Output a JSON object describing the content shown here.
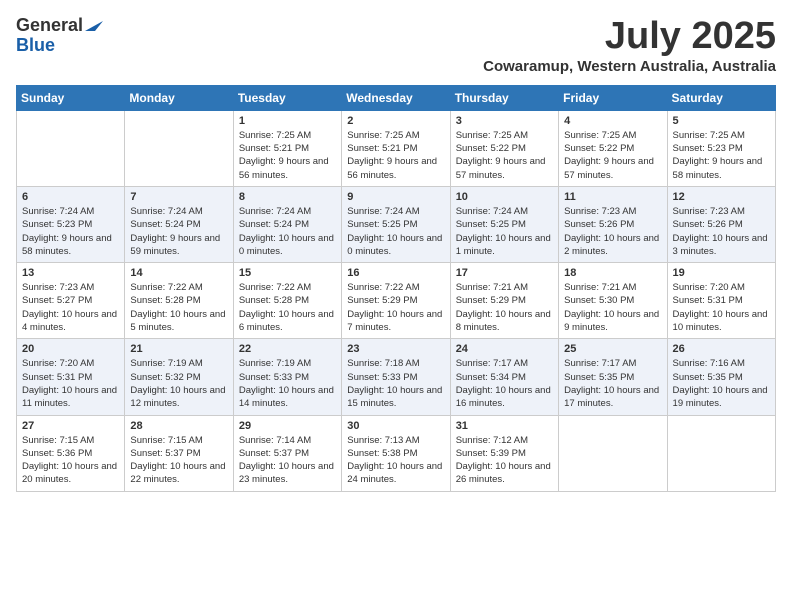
{
  "logo": {
    "general": "General",
    "blue": "Blue"
  },
  "title": {
    "month": "July 2025",
    "location": "Cowaramup, Western Australia, Australia"
  },
  "days_of_week": [
    "Sunday",
    "Monday",
    "Tuesday",
    "Wednesday",
    "Thursday",
    "Friday",
    "Saturday"
  ],
  "weeks": [
    [
      {
        "day": "",
        "info": ""
      },
      {
        "day": "",
        "info": ""
      },
      {
        "day": "1",
        "info": "Sunrise: 7:25 AM\nSunset: 5:21 PM\nDaylight: 9 hours and 56 minutes."
      },
      {
        "day": "2",
        "info": "Sunrise: 7:25 AM\nSunset: 5:21 PM\nDaylight: 9 hours and 56 minutes."
      },
      {
        "day": "3",
        "info": "Sunrise: 7:25 AM\nSunset: 5:22 PM\nDaylight: 9 hours and 57 minutes."
      },
      {
        "day": "4",
        "info": "Sunrise: 7:25 AM\nSunset: 5:22 PM\nDaylight: 9 hours and 57 minutes."
      },
      {
        "day": "5",
        "info": "Sunrise: 7:25 AM\nSunset: 5:23 PM\nDaylight: 9 hours and 58 minutes."
      }
    ],
    [
      {
        "day": "6",
        "info": "Sunrise: 7:24 AM\nSunset: 5:23 PM\nDaylight: 9 hours and 58 minutes."
      },
      {
        "day": "7",
        "info": "Sunrise: 7:24 AM\nSunset: 5:24 PM\nDaylight: 9 hours and 59 minutes."
      },
      {
        "day": "8",
        "info": "Sunrise: 7:24 AM\nSunset: 5:24 PM\nDaylight: 10 hours and 0 minutes."
      },
      {
        "day": "9",
        "info": "Sunrise: 7:24 AM\nSunset: 5:25 PM\nDaylight: 10 hours and 0 minutes."
      },
      {
        "day": "10",
        "info": "Sunrise: 7:24 AM\nSunset: 5:25 PM\nDaylight: 10 hours and 1 minute."
      },
      {
        "day": "11",
        "info": "Sunrise: 7:23 AM\nSunset: 5:26 PM\nDaylight: 10 hours and 2 minutes."
      },
      {
        "day": "12",
        "info": "Sunrise: 7:23 AM\nSunset: 5:26 PM\nDaylight: 10 hours and 3 minutes."
      }
    ],
    [
      {
        "day": "13",
        "info": "Sunrise: 7:23 AM\nSunset: 5:27 PM\nDaylight: 10 hours and 4 minutes."
      },
      {
        "day": "14",
        "info": "Sunrise: 7:22 AM\nSunset: 5:28 PM\nDaylight: 10 hours and 5 minutes."
      },
      {
        "day": "15",
        "info": "Sunrise: 7:22 AM\nSunset: 5:28 PM\nDaylight: 10 hours and 6 minutes."
      },
      {
        "day": "16",
        "info": "Sunrise: 7:22 AM\nSunset: 5:29 PM\nDaylight: 10 hours and 7 minutes."
      },
      {
        "day": "17",
        "info": "Sunrise: 7:21 AM\nSunset: 5:29 PM\nDaylight: 10 hours and 8 minutes."
      },
      {
        "day": "18",
        "info": "Sunrise: 7:21 AM\nSunset: 5:30 PM\nDaylight: 10 hours and 9 minutes."
      },
      {
        "day": "19",
        "info": "Sunrise: 7:20 AM\nSunset: 5:31 PM\nDaylight: 10 hours and 10 minutes."
      }
    ],
    [
      {
        "day": "20",
        "info": "Sunrise: 7:20 AM\nSunset: 5:31 PM\nDaylight: 10 hours and 11 minutes."
      },
      {
        "day": "21",
        "info": "Sunrise: 7:19 AM\nSunset: 5:32 PM\nDaylight: 10 hours and 12 minutes."
      },
      {
        "day": "22",
        "info": "Sunrise: 7:19 AM\nSunset: 5:33 PM\nDaylight: 10 hours and 14 minutes."
      },
      {
        "day": "23",
        "info": "Sunrise: 7:18 AM\nSunset: 5:33 PM\nDaylight: 10 hours and 15 minutes."
      },
      {
        "day": "24",
        "info": "Sunrise: 7:17 AM\nSunset: 5:34 PM\nDaylight: 10 hours and 16 minutes."
      },
      {
        "day": "25",
        "info": "Sunrise: 7:17 AM\nSunset: 5:35 PM\nDaylight: 10 hours and 17 minutes."
      },
      {
        "day": "26",
        "info": "Sunrise: 7:16 AM\nSunset: 5:35 PM\nDaylight: 10 hours and 19 minutes."
      }
    ],
    [
      {
        "day": "27",
        "info": "Sunrise: 7:15 AM\nSunset: 5:36 PM\nDaylight: 10 hours and 20 minutes."
      },
      {
        "day": "28",
        "info": "Sunrise: 7:15 AM\nSunset: 5:37 PM\nDaylight: 10 hours and 22 minutes."
      },
      {
        "day": "29",
        "info": "Sunrise: 7:14 AM\nSunset: 5:37 PM\nDaylight: 10 hours and 23 minutes."
      },
      {
        "day": "30",
        "info": "Sunrise: 7:13 AM\nSunset: 5:38 PM\nDaylight: 10 hours and 24 minutes."
      },
      {
        "day": "31",
        "info": "Sunrise: 7:12 AM\nSunset: 5:39 PM\nDaylight: 10 hours and 26 minutes."
      },
      {
        "day": "",
        "info": ""
      },
      {
        "day": "",
        "info": ""
      }
    ]
  ]
}
